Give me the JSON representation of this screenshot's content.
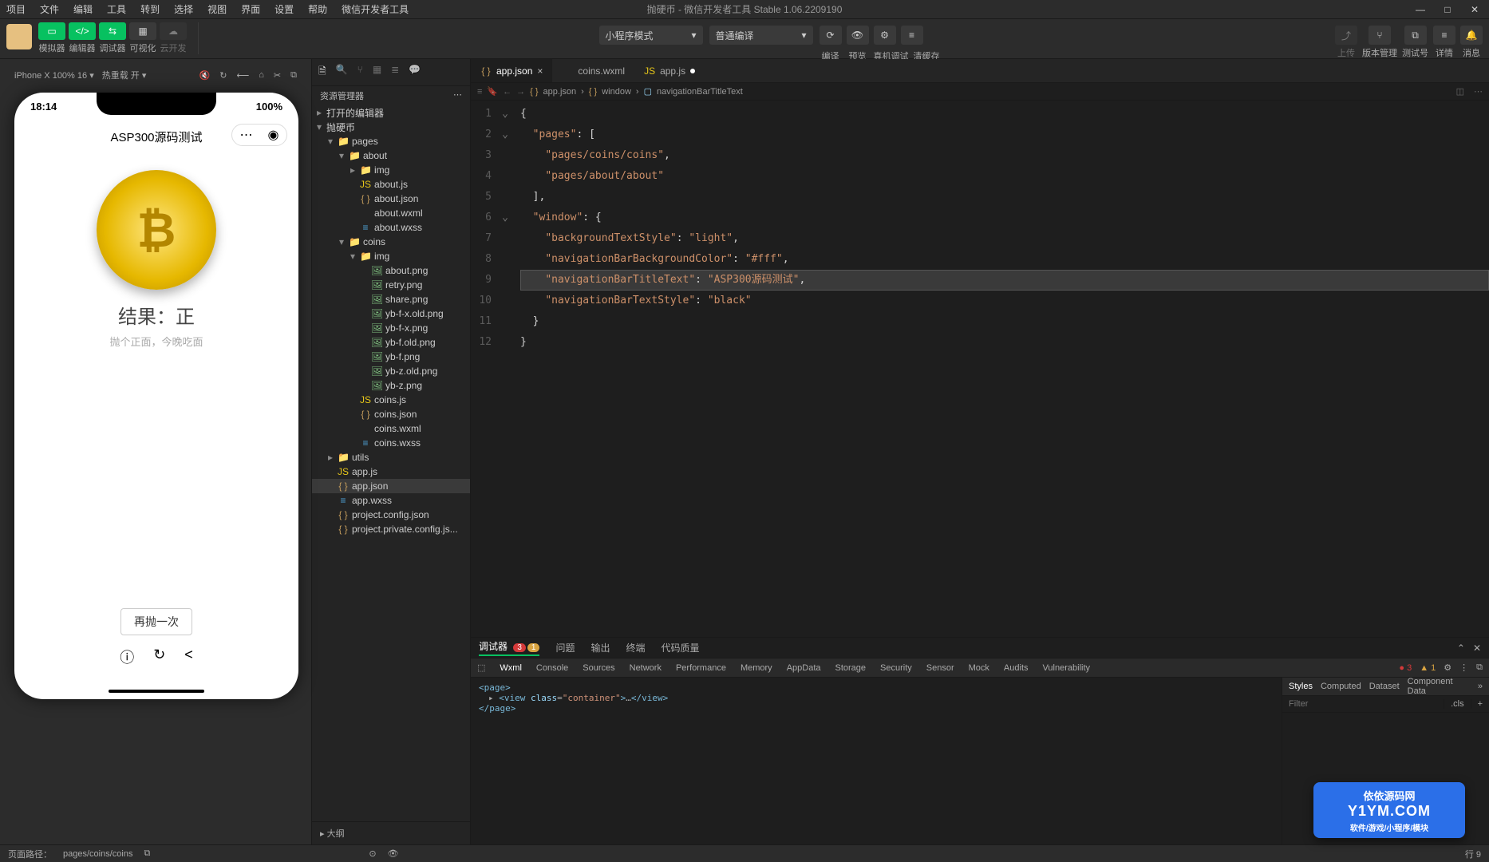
{
  "menubar": [
    "项目",
    "文件",
    "编辑",
    "工具",
    "转到",
    "选择",
    "视图",
    "界面",
    "设置",
    "帮助",
    "微信开发者工具"
  ],
  "title": "抛硬币 - 微信开发者工具 Stable 1.06.2209190",
  "toolbar": {
    "labels": [
      "模拟器",
      "编辑器",
      "调试器",
      "可视化",
      "云开发"
    ],
    "mode_select": "小程序模式",
    "compile_select": "普通编译",
    "actions": [
      "编译",
      "预览",
      "真机调试",
      "清缓存"
    ],
    "right_labels": [
      "上传",
      "版本管理",
      "测试号",
      "详情",
      "消息"
    ]
  },
  "simbar": {
    "device": "iPhone X 100% 16",
    "hot": "热重载 开"
  },
  "phone": {
    "time": "18:14",
    "battery": "100%",
    "title": "ASP300源码测试",
    "coin": "₿",
    "result": "结果：正",
    "sub": "抛个正面，今晚吃面",
    "btn": "再抛一次"
  },
  "explorer": {
    "title": "资源管理器",
    "open_editors": "打开的编辑器",
    "root": "抛硬币",
    "tree": [
      {
        "d": 1,
        "t": "f",
        "n": "pages",
        "open": true
      },
      {
        "d": 2,
        "t": "f",
        "n": "about",
        "open": true
      },
      {
        "d": 3,
        "t": "f",
        "n": "img",
        "open": false
      },
      {
        "d": 3,
        "t": "js",
        "n": "about.js"
      },
      {
        "d": 3,
        "t": "json",
        "n": "about.json"
      },
      {
        "d": 3,
        "t": "wxml",
        "n": "about.wxml"
      },
      {
        "d": 3,
        "t": "wxss",
        "n": "about.wxss"
      },
      {
        "d": 2,
        "t": "f",
        "n": "coins",
        "open": true
      },
      {
        "d": 3,
        "t": "f",
        "n": "img",
        "open": true
      },
      {
        "d": 4,
        "t": "png",
        "n": "about.png"
      },
      {
        "d": 4,
        "t": "png",
        "n": "retry.png"
      },
      {
        "d": 4,
        "t": "png",
        "n": "share.png"
      },
      {
        "d": 4,
        "t": "png",
        "n": "yb-f-x.old.png"
      },
      {
        "d": 4,
        "t": "png",
        "n": "yb-f-x.png"
      },
      {
        "d": 4,
        "t": "png",
        "n": "yb-f.old.png"
      },
      {
        "d": 4,
        "t": "png",
        "n": "yb-f.png"
      },
      {
        "d": 4,
        "t": "png",
        "n": "yb-z.old.png"
      },
      {
        "d": 4,
        "t": "png",
        "n": "yb-z.png"
      },
      {
        "d": 3,
        "t": "js",
        "n": "coins.js"
      },
      {
        "d": 3,
        "t": "json",
        "n": "coins.json"
      },
      {
        "d": 3,
        "t": "wxml",
        "n": "coins.wxml"
      },
      {
        "d": 3,
        "t": "wxss",
        "n": "coins.wxss"
      },
      {
        "d": 1,
        "t": "f",
        "n": "utils",
        "open": false
      },
      {
        "d": 1,
        "t": "js",
        "n": "app.js"
      },
      {
        "d": 1,
        "t": "json",
        "n": "app.json",
        "sel": true
      },
      {
        "d": 1,
        "t": "wxss",
        "n": "app.wxss"
      },
      {
        "d": 1,
        "t": "json",
        "n": "project.config.json"
      },
      {
        "d": 1,
        "t": "json",
        "n": "project.private.config.js..."
      }
    ],
    "outline": "大纲"
  },
  "tabs": [
    {
      "icon": "json",
      "name": "app.json",
      "active": true,
      "close": "x"
    },
    {
      "icon": "wxml",
      "name": "coins.wxml",
      "active": false,
      "close": ""
    },
    {
      "icon": "js",
      "name": "app.js",
      "active": false,
      "close": "dot"
    }
  ],
  "breadcrumb": [
    "app.json",
    "{ }",
    "window",
    "navigationBarTitleText"
  ],
  "code": {
    "pages1": "pages/coins/coins",
    "pages2": "pages/about/about",
    "bgts": "light",
    "nbbg": "#fff",
    "nbtt": "ASP300源码测试",
    "nbts": "black"
  },
  "bottom": {
    "tabs": [
      "调试器",
      "问题",
      "输出",
      "终端",
      "代码质量"
    ],
    "err": "3",
    "warn": "1",
    "devtabs": [
      "Wxml",
      "Console",
      "Sources",
      "Network",
      "Performance",
      "Memory",
      "AppData",
      "Storage",
      "Security",
      "Sensor",
      "Mock",
      "Audits",
      "Vulnerability"
    ],
    "styletabs": [
      "Styles",
      "Computed",
      "Dataset",
      "Component Data"
    ],
    "filter_ph": "Filter",
    "cls": ".cls",
    "dom": {
      "l1": "<page>",
      "l2": "<view class=\"container\">…</view>",
      "l3": "</page>"
    }
  },
  "status": {
    "path_label": "页面路径：",
    "path": "pages/coins/coins",
    "pos": "行 9"
  },
  "watermark": {
    "t1": "依依源码网",
    "t2": "Y1YM.COM",
    "t3": "软件/游戏/小程序/模块"
  }
}
